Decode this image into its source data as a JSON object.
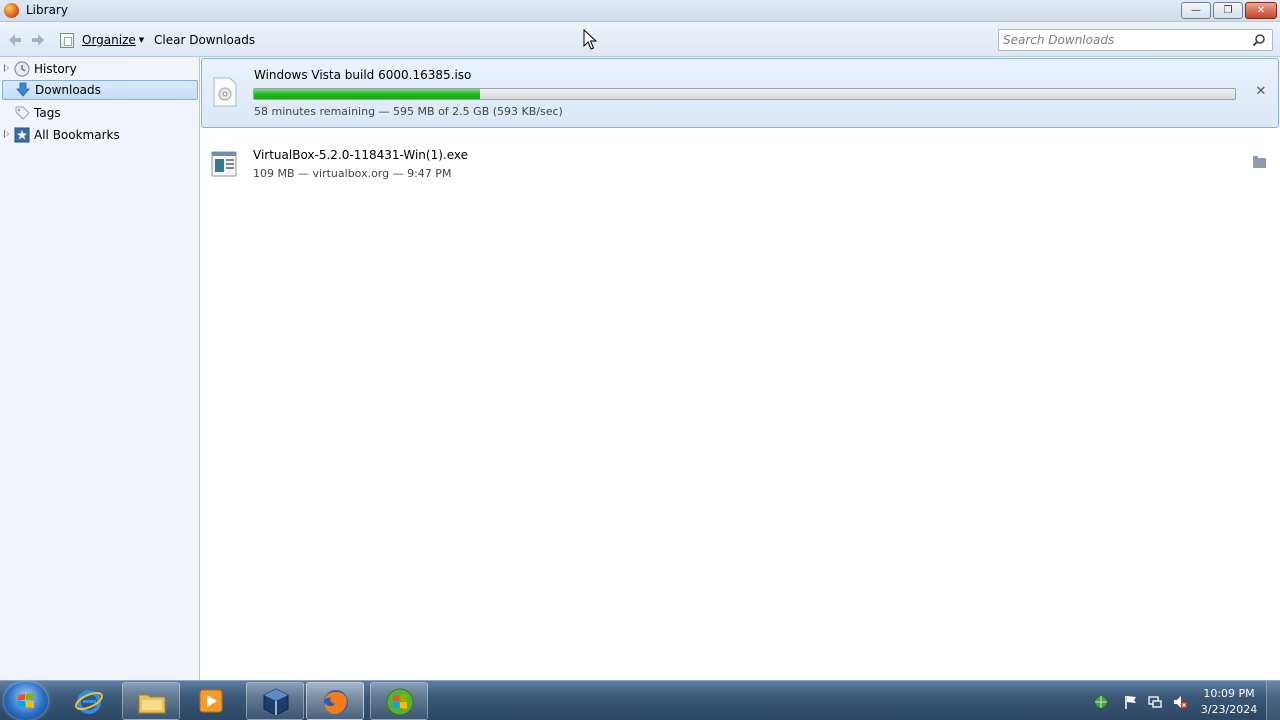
{
  "window": {
    "title": "Library",
    "controls": {
      "minimize": "—",
      "maximize": "❐",
      "close": "✕"
    }
  },
  "toolbar": {
    "back_icon": "back-arrow-icon",
    "forward_icon": "forward-arrow-icon",
    "organize_label": "Organize",
    "clear_label": "Clear Downloads",
    "search_placeholder": "Search Downloads"
  },
  "sidebar": {
    "items": [
      {
        "label": "History",
        "icon": "clock-icon",
        "expandable": true
      },
      {
        "label": "Downloads",
        "icon": "download-arrow-icon",
        "selected": true
      },
      {
        "label": "Tags",
        "icon": "tag-icon"
      },
      {
        "label": "All Bookmarks",
        "icon": "bookmarks-star-icon",
        "expandable": true
      }
    ]
  },
  "downloads": [
    {
      "name": "Windows Vista build 6000.16385.iso",
      "status": "58 minutes remaining — 595 MB of 2.5 GB (593 KB/sec)",
      "progress": 0.23,
      "action": "cancel",
      "action_glyph": "✕"
    },
    {
      "name": "VirtualBox-5.2.0-118431-Win(1).exe",
      "status": "109 MB — virtualbox.org — 9:47 PM",
      "action": "show-in-folder"
    }
  ],
  "taskbar": {
    "apps": [
      "internet-explorer",
      "windows-explorer",
      "media-player",
      "virtualbox",
      "firefox",
      "windows-update"
    ],
    "active_app": "firefox",
    "clock_time": "10:09 PM",
    "clock_date": "3/23/2024"
  },
  "colors": {
    "progress_fill": "#25b821",
    "selection": "#c4dcf6",
    "taskbar": "#3b5877"
  }
}
